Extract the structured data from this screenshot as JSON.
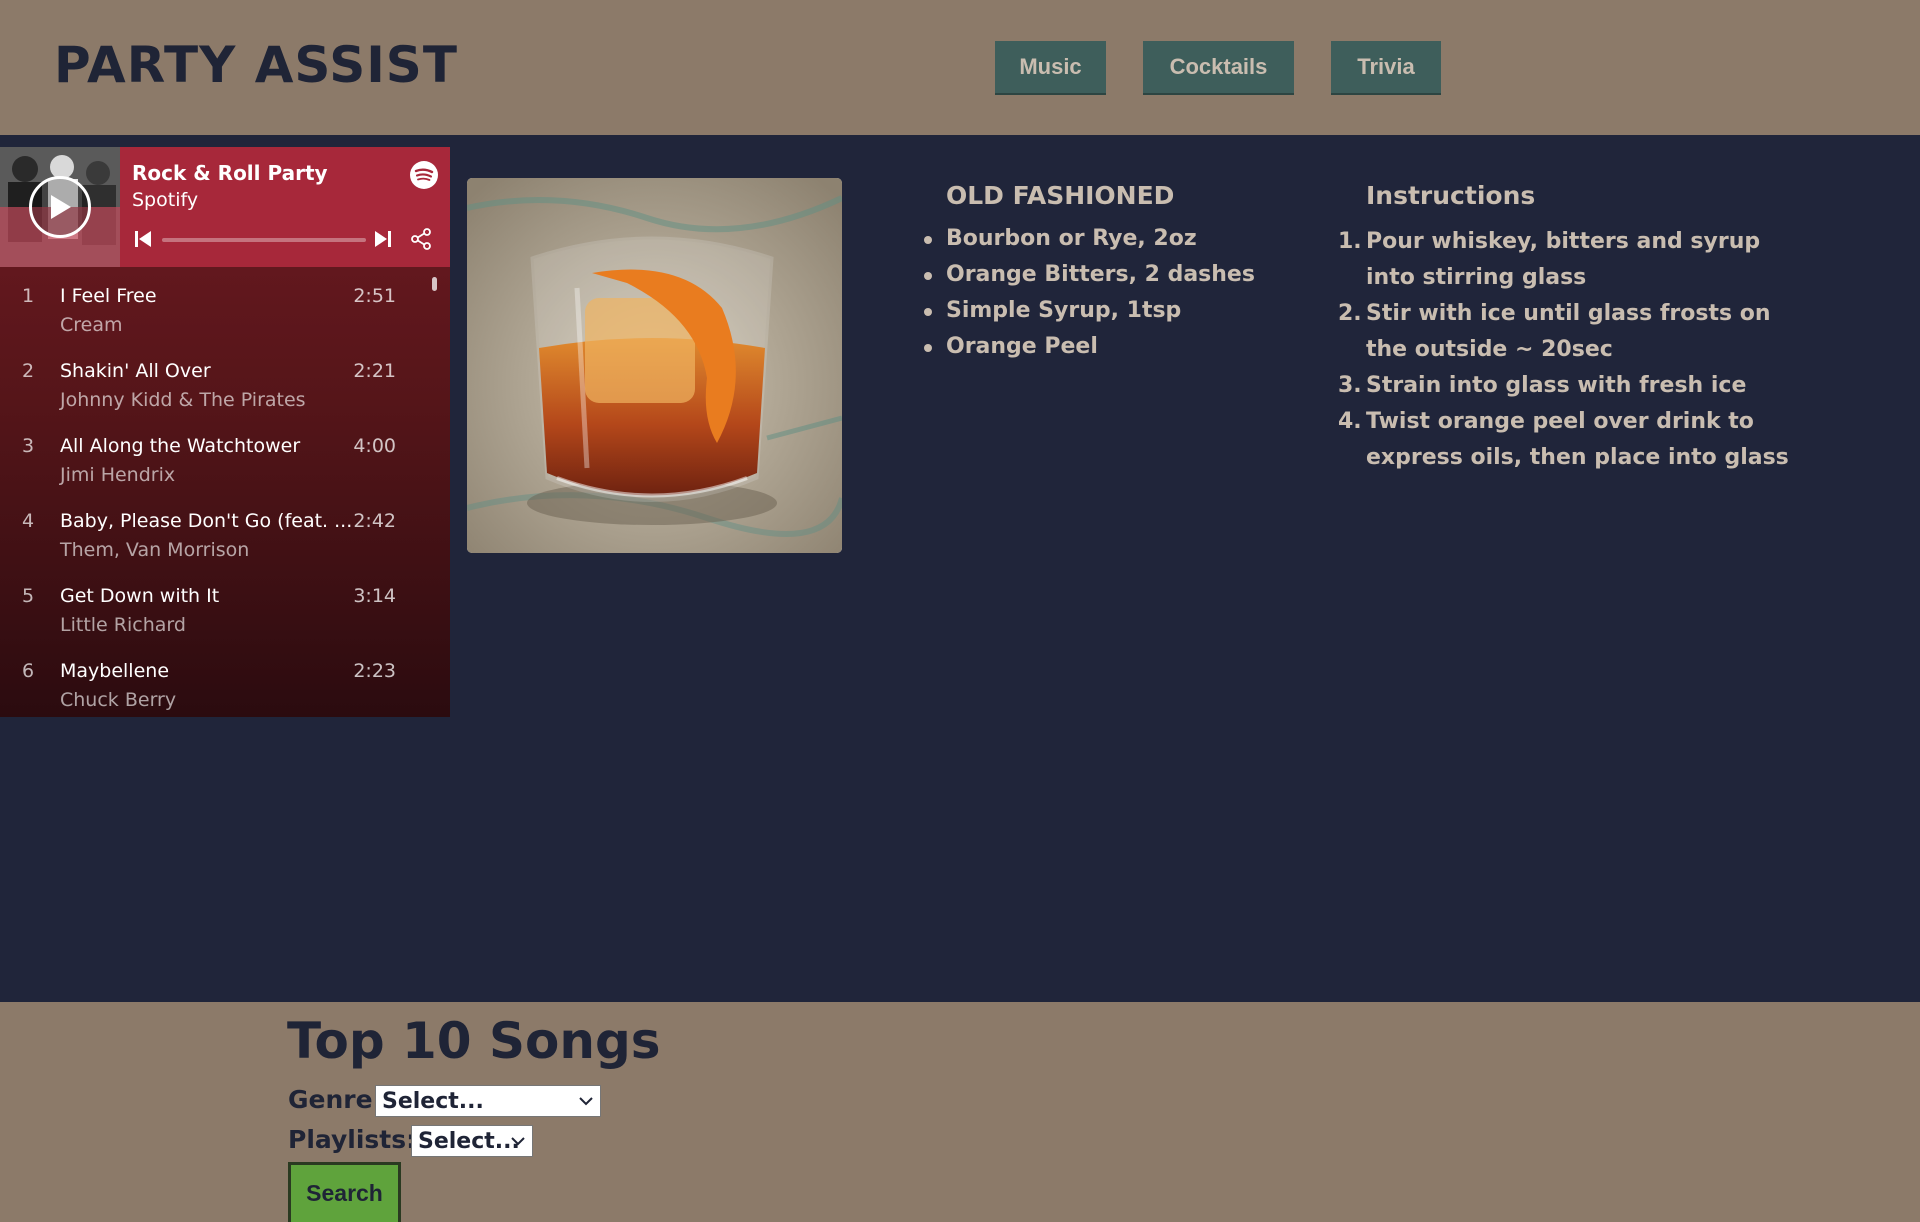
{
  "app": {
    "title": "PARTY ASSIST"
  },
  "nav": [
    {
      "label": "Music"
    },
    {
      "label": "Cocktails"
    },
    {
      "label": "Trivia"
    }
  ],
  "player": {
    "playlist_title": "Rock & Roll Party",
    "source": "Spotify",
    "progress": 0,
    "tracks": [
      {
        "num": "1",
        "name": "I Feel Free",
        "artist": "Cream",
        "duration": "2:51"
      },
      {
        "num": "2",
        "name": "Shakin' All Over",
        "artist": "Johnny Kidd & The Pirates",
        "duration": "2:21"
      },
      {
        "num": "3",
        "name": "All Along the Watchtower",
        "artist": "Jimi Hendrix",
        "duration": "4:00"
      },
      {
        "num": "4",
        "name": "Baby, Please Don't Go (feat. ...",
        "artist": "Them, Van Morrison",
        "duration": "2:42"
      },
      {
        "num": "5",
        "name": "Get Down with It",
        "artist": "Little Richard",
        "duration": "3:14"
      },
      {
        "num": "6",
        "name": "Maybellene",
        "artist": "Chuck Berry",
        "duration": "2:23"
      }
    ]
  },
  "cocktail": {
    "name": "OLD FASHIONED",
    "ingredients": [
      "Bourbon or Rye, 2oz",
      "Orange Bitters, 2 dashes",
      "Simple Syrup, 1tsp",
      "Orange Peel"
    ],
    "instructions_title": "Instructions",
    "instructions": [
      {
        "n": "1.",
        "text": "Pour whiskey, bitters and syrup into stirring glass"
      },
      {
        "n": "2.",
        "text": "Stir with ice until glass frosts on the outside ~ 20sec"
      },
      {
        "n": "3.",
        "text": "Strain into glass with fresh ice"
      },
      {
        "n": "4.",
        "text": "Twist orange peel over drink to express oils, then place into glass"
      }
    ]
  },
  "top_songs": {
    "title": "Top 10 Songs",
    "genre_label": "Genre:",
    "genre_value": "Select...",
    "playlists_label": "Playlists:",
    "playlists_value": "Select...",
    "search_label": "Search"
  },
  "colors": {
    "header_bg": "#8c7a69",
    "main_bg": "#20253a",
    "nav_button": "#3e5e5b",
    "player_accent": "#a7283a",
    "search_button": "#5fa33c",
    "text_light": "#c9bdb0",
    "text_dark": "#1f2436"
  }
}
